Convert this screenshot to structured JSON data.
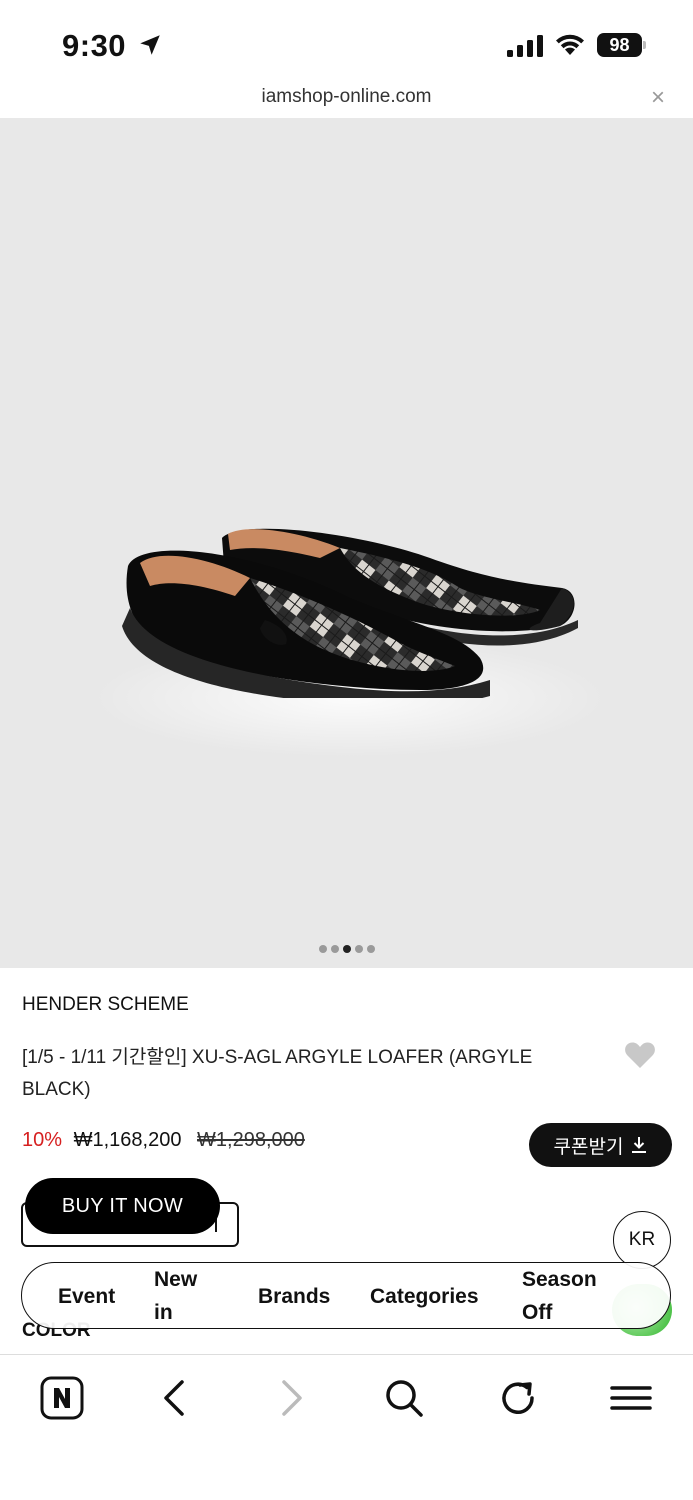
{
  "status_bar": {
    "time": "9:30",
    "battery": "98",
    "icons": [
      "location-arrow-icon",
      "signal-icon",
      "wifi-icon",
      "battery-icon"
    ]
  },
  "url_bar": {
    "url": "iamshop-online.com",
    "close_label": "×"
  },
  "gallery": {
    "image_subject": "black suede argyle loafers",
    "page_count": 5,
    "active_index": 2
  },
  "product": {
    "brand": "HENDER SCHEME",
    "title": "[1/5 - 1/11 기간할인] XU-S-AGL ARGYLE LOAFER (ARGYLE BLACK)",
    "discount": "10%",
    "sale_price": "₩1,168,200",
    "original_price": "₩1,298,000",
    "coupon_label": "쿠폰받기",
    "buy_now_label": "BUY IT NOW",
    "color_label": "COLOR",
    "wishlist_icon": "heart-icon"
  },
  "locale_button": "KR",
  "nav": {
    "items": [
      {
        "label": "Event"
      },
      {
        "label": "New in"
      },
      {
        "label": "Brands"
      },
      {
        "label": "Categories"
      },
      {
        "label": "Season Off"
      }
    ]
  },
  "toolbar": {
    "icons": [
      "naver-app-icon",
      "back-icon",
      "forward-icon",
      "search-icon",
      "reload-icon",
      "menu-icon"
    ]
  },
  "colors": {
    "discount": "#d62020",
    "button_bg": "#111111",
    "gallery_bg": "#e8e8e8",
    "chat_green": "#2fb52a"
  }
}
